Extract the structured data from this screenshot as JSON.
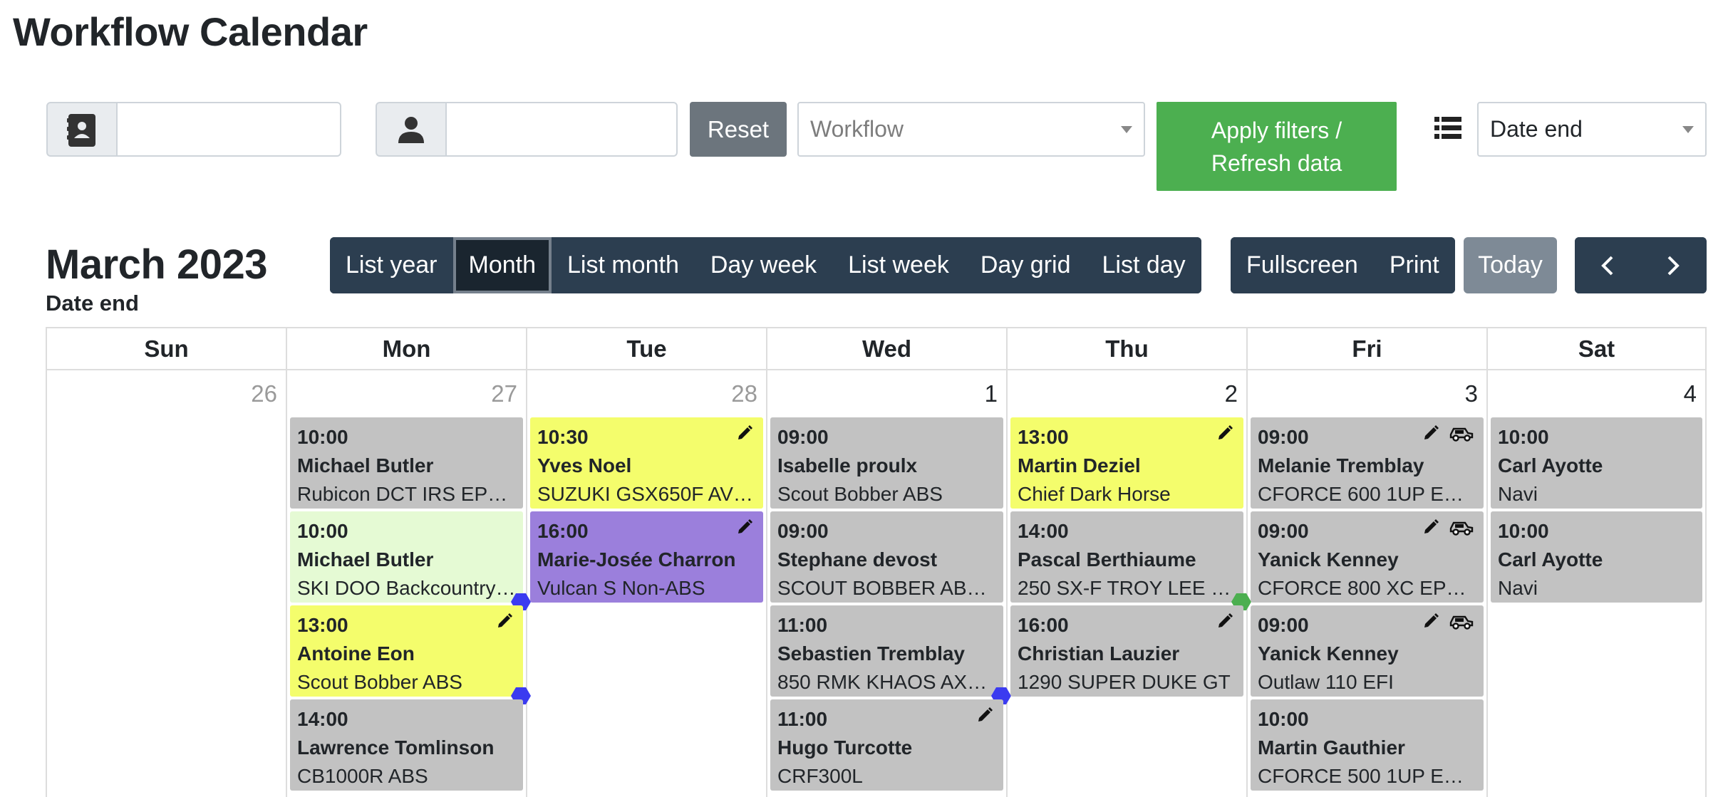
{
  "page_title": "Workflow Calendar",
  "filters": {
    "contact_value": "",
    "user_value": "",
    "reset_label": "Reset",
    "workflow_placeholder": "Workflow",
    "apply_label_line1": "Apply filters /",
    "apply_label_line2": "Refresh data",
    "date_field_value": "Date end"
  },
  "toolbar": {
    "title": "March 2023",
    "subtitle": "Date end",
    "views": [
      "List year",
      "Month",
      "List month",
      "Day week",
      "List week",
      "Day grid",
      "List day"
    ],
    "active_view": "Month",
    "fullscreen_label": "Fullscreen",
    "print_label": "Print",
    "today_label": "Today",
    "prev_icon": "chevron-left-icon",
    "next_icon": "chevron-right-icon"
  },
  "calendar": {
    "days_of_week": [
      "Sun",
      "Mon",
      "Tue",
      "Wed",
      "Thu",
      "Fri",
      "Sat"
    ],
    "days": [
      {
        "num": "26",
        "other": true,
        "events": []
      },
      {
        "num": "27",
        "other": true,
        "events": [
          {
            "time": "10:00",
            "name": "Michael Butler",
            "desc": "Rubicon DCT IRS EPS…",
            "color": "grey",
            "icons": []
          },
          {
            "time": "10:00",
            "name": "Michael Butler",
            "desc": "SKI DOO Backcountry …",
            "color": "lightgreen",
            "icons": [],
            "tag": "#3b3bf0"
          },
          {
            "time": "13:00",
            "name": "Antoine Eon",
            "desc": "Scout Bobber ABS",
            "color": "yellow",
            "icons": [
              "pencil"
            ],
            "tag": "#3b3bf0"
          },
          {
            "time": "14:00",
            "name": "Lawrence Tomlinson",
            "desc": "CB1000R ABS",
            "color": "grey",
            "icons": []
          }
        ]
      },
      {
        "num": "28",
        "other": true,
        "events": [
          {
            "time": "10:30",
            "name": "Yves Noel",
            "desc": "SUZUKI GSX650F AV…",
            "color": "yellow",
            "icons": [
              "pencil"
            ]
          },
          {
            "time": "16:00",
            "name": "Marie-Josée Charron",
            "desc": "Vulcan S Non-ABS",
            "color": "purple",
            "icons": [
              "pencil"
            ]
          }
        ]
      },
      {
        "num": "1",
        "other": false,
        "events": [
          {
            "time": "09:00",
            "name": "Isabelle proulx",
            "desc": "Scout Bobber ABS",
            "color": "grey",
            "icons": []
          },
          {
            "time": "09:00",
            "name": "Stephane devost",
            "desc": "SCOUT BOBBER ABS…",
            "color": "grey",
            "icons": []
          },
          {
            "time": "11:00",
            "name": "Sebastien Tremblay",
            "desc": "850 RMK KHAOS AXY…",
            "color": "grey",
            "icons": [],
            "tag": "#3b3bf0"
          },
          {
            "time": "11:00",
            "name": "Hugo Turcotte",
            "desc": "CRF300L",
            "color": "grey",
            "icons": [
              "pencil"
            ]
          }
        ]
      },
      {
        "num": "2",
        "other": false,
        "events": [
          {
            "time": "13:00",
            "name": "Martin Deziel",
            "desc": "Chief Dark Horse",
            "color": "yellow",
            "icons": [
              "pencil"
            ]
          },
          {
            "time": "14:00",
            "name": "Pascal Berthiaume",
            "desc": "250 SX-F TROY LEE …",
            "color": "grey",
            "icons": [],
            "tag": "#4caf50"
          },
          {
            "time": "16:00",
            "name": "Christian Lauzier",
            "desc": "1290 SUPER DUKE GT",
            "color": "grey",
            "icons": [
              "pencil"
            ]
          }
        ]
      },
      {
        "num": "3",
        "other": false,
        "events": [
          {
            "time": "09:00",
            "name": "Melanie Tremblay",
            "desc": "CFORCE 600 1UP EP…",
            "color": "grey",
            "icons": [
              "pencil",
              "truck"
            ]
          },
          {
            "time": "09:00",
            "name": "Yanick Kenney",
            "desc": "CFORCE 800 XC EPS…",
            "color": "grey",
            "icons": [
              "pencil",
              "truck"
            ]
          },
          {
            "time": "09:00",
            "name": "Yanick Kenney",
            "desc": "Outlaw 110 EFI",
            "color": "grey",
            "icons": [
              "pencil",
              "truck"
            ]
          },
          {
            "time": "10:00",
            "name": "Martin Gauthier",
            "desc": "CFORCE 500 1UP EP…",
            "color": "grey",
            "icons": []
          }
        ]
      },
      {
        "num": "4",
        "other": false,
        "events": [
          {
            "time": "10:00",
            "name": "Carl Ayotte",
            "desc": "Navi",
            "color": "grey",
            "icons": []
          },
          {
            "time": "10:00",
            "name": "Carl Ayotte",
            "desc": "Navi",
            "color": "grey",
            "icons": []
          }
        ]
      }
    ]
  }
}
